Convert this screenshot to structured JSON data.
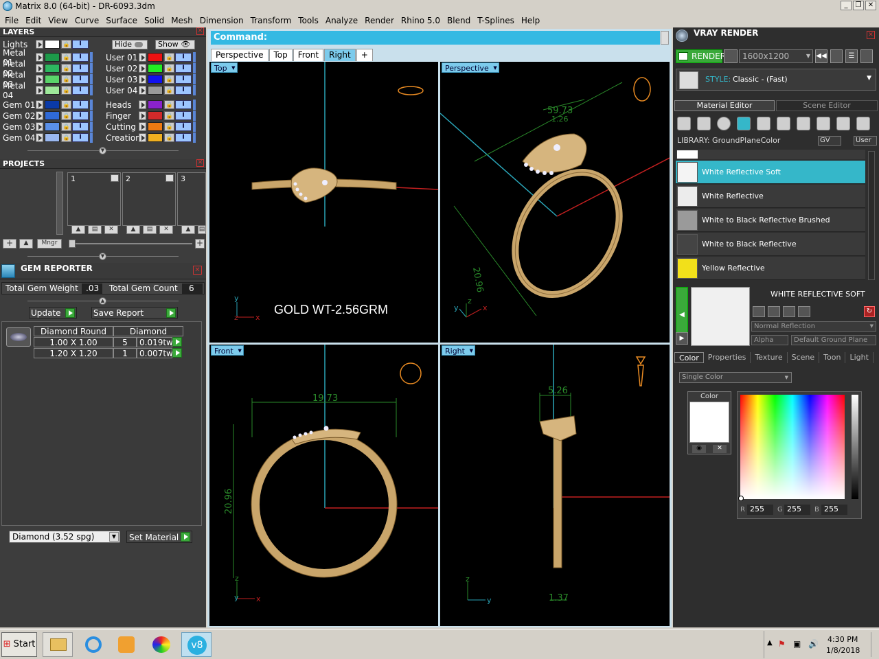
{
  "window": {
    "title": "Matrix 8.0 (64-bit) - DR-6093.3dm"
  },
  "menu": [
    "File",
    "Edit",
    "View",
    "Curve",
    "Surface",
    "Solid",
    "Mesh",
    "Dimension",
    "Transform",
    "Tools",
    "Analyze",
    "Render",
    "Rhino 5.0",
    "Blend",
    "T-Splines",
    "Help"
  ],
  "layers": {
    "title": "LAYERS",
    "lights_label": "Lights",
    "hide_label": "Hide",
    "show_label": "Show",
    "left": [
      {
        "name": "Metal 01",
        "color": "#1d9a4a"
      },
      {
        "name": "Metal 02",
        "color": "#2db860"
      },
      {
        "name": "Metal 03",
        "color": "#5ad46a"
      },
      {
        "name": "Metal 04",
        "color": "#9ee89a"
      },
      {
        "name": "Gem 01",
        "color": "#0a3aa8"
      },
      {
        "name": "Gem 02",
        "color": "#2f6ad8"
      },
      {
        "name": "Gem 03",
        "color": "#5a90e8"
      },
      {
        "name": "Gem 04",
        "color": "#9ab8f0"
      }
    ],
    "right": [
      {
        "name": "User 01",
        "color": "#ee1111"
      },
      {
        "name": "User 02",
        "color": "#22ee22"
      },
      {
        "name": "User 03",
        "color": "#1111ee"
      },
      {
        "name": "User 04",
        "color": "#9a9a9a"
      },
      {
        "name": "Heads",
        "color": "#8a22cc"
      },
      {
        "name": "Finger",
        "color": "#d22a2a"
      },
      {
        "name": "Cutting",
        "color": "#ee7a11"
      },
      {
        "name": "Creation",
        "color": "#f0b020"
      }
    ]
  },
  "projects": {
    "title": "PROJECTS",
    "slots": [
      "1",
      "2",
      "3"
    ],
    "mngr": "Mngr"
  },
  "gem_reporter": {
    "title": "GEM REPORTER",
    "total_weight_label": "Total Gem Weight",
    "total_weight": ".03",
    "total_count_label": "Total Gem Count",
    "total_count": "6",
    "update": "Update",
    "save_report": "Save Report",
    "col1": "Diamond Round",
    "col2": "Diamond",
    "rows": [
      {
        "size": "1.00 X 1.00",
        "qty": "5",
        "wt": "0.019tw"
      },
      {
        "size": "1.20 X 1.20",
        "qty": "1",
        "wt": "0.007tw"
      }
    ],
    "material_select": "Diamond    (3.52 spg)",
    "set_material": "Set Material"
  },
  "command": {
    "label": "Command:"
  },
  "view_tabs": [
    "Perspective",
    "Top",
    "Front",
    "Right",
    "+"
  ],
  "active_view_tab": "Right",
  "viewports": {
    "top": {
      "label": "Top"
    },
    "perspective": {
      "label": "Perspective"
    },
    "front": {
      "label": "Front"
    },
    "right": {
      "label": "Right"
    },
    "gold_weight": "GOLD WT-2.56GRM",
    "dims_persp": [
      "59.73",
      "1.26",
      "20.96"
    ],
    "dims_front": [
      "19.73",
      "20.96"
    ],
    "dims_right": [
      "5.26",
      "1.37"
    ],
    "axis": {
      "x": "x",
      "y": "y",
      "z": "z"
    }
  },
  "vray": {
    "title": "VRAY RENDER",
    "render_btn": "RENDER",
    "resolution": "1600x1200",
    "style_label": "STYLE:",
    "style_value": "Classic - (Fast)",
    "tab_material": "Material Editor",
    "tab_scene": "Scene Editor",
    "library_label": "LIBRARY: GroundPlaneColor",
    "gv": "GV",
    "user": "User",
    "materials": [
      {
        "name": "White Reflective Soft",
        "color": "#f4f4f4",
        "selected": true
      },
      {
        "name": "White Reflective",
        "color": "#ececec",
        "selected": false
      },
      {
        "name": "White to Black Reflective Brushed",
        "color": "#9a9a9a",
        "selected": false
      },
      {
        "name": "White to Black Reflective",
        "color": "#444444",
        "selected": false
      },
      {
        "name": "Yellow Reflective",
        "color": "#f2e01a",
        "selected": false
      }
    ],
    "selected_name": "WHITE REFLECTIVE SOFT",
    "normal_reflection": "Normal Reflection",
    "alpha": "Alpha",
    "ground_plane": "Default Ground Plane",
    "sub_tabs": [
      "Color",
      "Properties",
      "Texture",
      "Scene",
      "Toon",
      "Light"
    ],
    "single_color": "Single Color",
    "color_label": "Color",
    "r_label": "R",
    "r": "255",
    "g_label": "G",
    "g": "255",
    "b_label": "B",
    "b": "255"
  },
  "taskbar": {
    "start": "Start",
    "time": "4:30 PM",
    "date": "1/8/2018"
  }
}
